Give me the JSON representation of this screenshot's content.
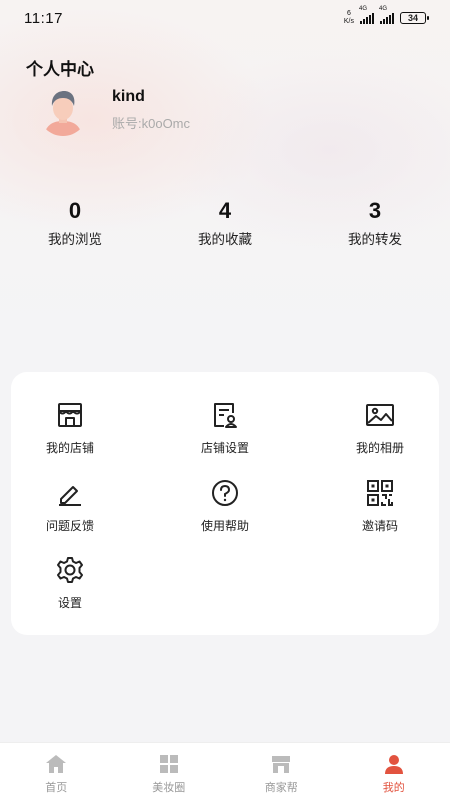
{
  "status_bar": {
    "time": "11:17",
    "speed_value": "6",
    "speed_unit": "K/s",
    "signal1_label": "4G",
    "signal2_label": "4G",
    "battery": "34"
  },
  "header": {
    "title": "个人中心",
    "username": "kind",
    "account": "账号:k0oOmc"
  },
  "stats": [
    {
      "value": "0",
      "label": "我的浏览"
    },
    {
      "value": "4",
      "label": "我的收藏"
    },
    {
      "value": "3",
      "label": "我的转发"
    }
  ],
  "menu": [
    {
      "label": "我的店铺",
      "icon": "store-icon"
    },
    {
      "label": "店铺设置",
      "icon": "store-settings-icon"
    },
    {
      "label": "我的相册",
      "icon": "image-icon"
    },
    {
      "label": "问题反馈",
      "icon": "edit-icon"
    },
    {
      "label": "使用帮助",
      "icon": "help-icon"
    },
    {
      "label": "邀请码",
      "icon": "qrcode-icon"
    },
    {
      "label": "设置",
      "icon": "gear-icon"
    }
  ],
  "tabbar": {
    "items": [
      {
        "label": "首页",
        "icon": "home-icon"
      },
      {
        "label": "美妆圈",
        "icon": "grid-icon"
      },
      {
        "label": "商家帮",
        "icon": "shop-icon"
      },
      {
        "label": "我的",
        "icon": "user-icon"
      }
    ],
    "active_index": 3,
    "active_color": "#e2533f",
    "inactive_color": "#bbbbbb"
  }
}
